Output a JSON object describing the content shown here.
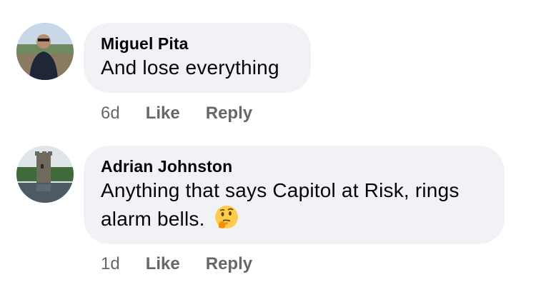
{
  "comments": [
    {
      "author": "Miguel Pita",
      "text": "And lose everything",
      "time": "6d",
      "like_label": "Like",
      "reply_label": "Reply"
    },
    {
      "author": "Adrian Johnston",
      "text_line1": "Anything that says Capitol at Risk, rings",
      "text_line2": "alarm bells.",
      "emoji": "thinking-face-emoji",
      "time": "1d",
      "like_label": "Like",
      "reply_label": "Reply"
    }
  ],
  "colors": {
    "bubble": "#f0f2f5",
    "text": "#050505",
    "secondary": "#65676b"
  }
}
